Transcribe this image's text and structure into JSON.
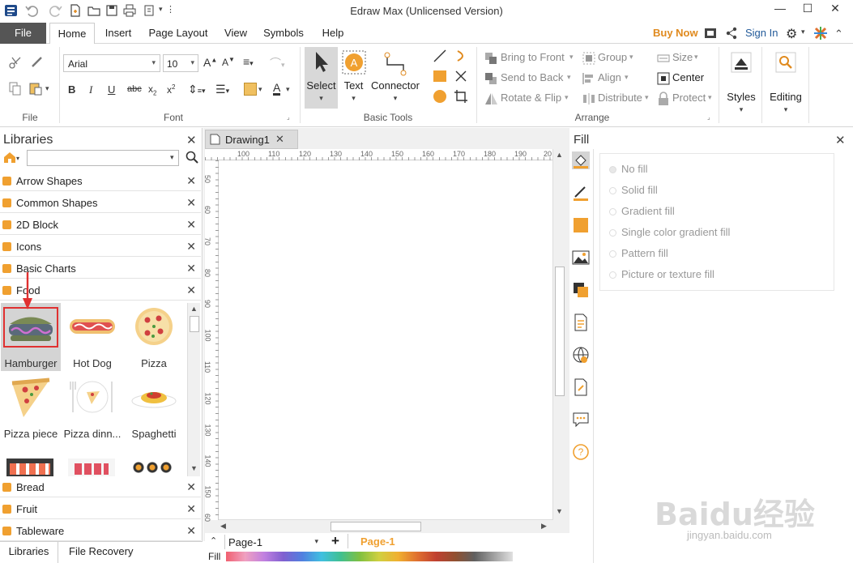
{
  "window": {
    "title": "Edraw Max (Unlicensed Version)",
    "minimize": "—",
    "maximize": "☐",
    "close": "✕"
  },
  "tabs": {
    "file": "File",
    "items": [
      "Home",
      "Insert",
      "Page Layout",
      "View",
      "Symbols",
      "Help"
    ],
    "active": "Home",
    "buy_now": "Buy Now",
    "sign_in": "Sign In"
  },
  "ribbon": {
    "file_group": "File",
    "font_group": "Font",
    "font_name": "Arial",
    "font_size": "10",
    "basic_tools_group": "Basic Tools",
    "select": "Select",
    "text": "Text",
    "connector": "Connector",
    "arrange_group": "Arrange",
    "bring_to_front": "Bring to Front",
    "send_to_back": "Send to Back",
    "rotate_flip": "Rotate & Flip",
    "group": "Group",
    "align": "Align",
    "distribute": "Distribute",
    "size": "Size",
    "center": "Center",
    "protect": "Protect",
    "styles": "Styles",
    "editing": "Editing"
  },
  "libraries": {
    "title": "Libraries",
    "search_placeholder": "",
    "categories_top": [
      "Arrow Shapes",
      "Common Shapes",
      "2D Block",
      "Icons",
      "Basic Charts",
      "Food"
    ],
    "shapes": [
      "Hamburger",
      "Hot Dog",
      "Pizza",
      "Pizza piece",
      "Pizza dinn...",
      "Spaghetti"
    ],
    "categories_bottom": [
      "Bread",
      "Fruit",
      "Tableware"
    ],
    "bottom_tabs": [
      "Libraries",
      "File Recovery"
    ]
  },
  "document": {
    "tab": "Drawing1",
    "ruler_h": [
      "100",
      "110",
      "120",
      "130",
      "140",
      "150",
      "160",
      "170",
      "180",
      "190",
      "20"
    ],
    "ruler_v": [
      "50",
      "60",
      "70",
      "80",
      "90",
      "100",
      "110",
      "120",
      "130",
      "140",
      "150",
      "60"
    ],
    "page_select": "Page-1",
    "page_tab": "Page-1",
    "fill_label": "Fill"
  },
  "fill_panel": {
    "title": "Fill",
    "options": [
      "No fill",
      "Solid fill",
      "Gradient fill",
      "Single color gradient fill",
      "Pattern fill",
      "Picture or texture fill"
    ],
    "selected": "No fill"
  },
  "colors": {
    "accent_orange": "#f0a030",
    "file_tab_bg": "#555555",
    "buy_now": "#e08a1e",
    "highlight_red": "#e03030"
  },
  "watermark": {
    "brand": "Baidu经验",
    "url": "jingyan.baidu.com"
  }
}
